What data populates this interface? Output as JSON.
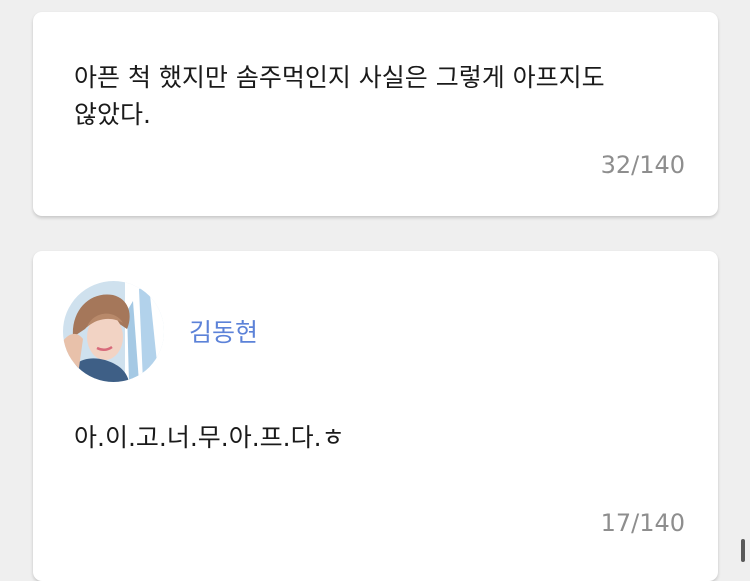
{
  "posts": [
    {
      "message": "아픈 척 했지만 솜주먹인지 사실은 그렇게 아프지도 않았다.",
      "char_count": "32/140"
    },
    {
      "author": {
        "name": "김동현",
        "avatar_icon": "profile-photo",
        "name_color": "#5c82d8"
      },
      "message": "아.이.고.너.무.아.프.다.ㅎ",
      "char_count": "17/140"
    }
  ]
}
